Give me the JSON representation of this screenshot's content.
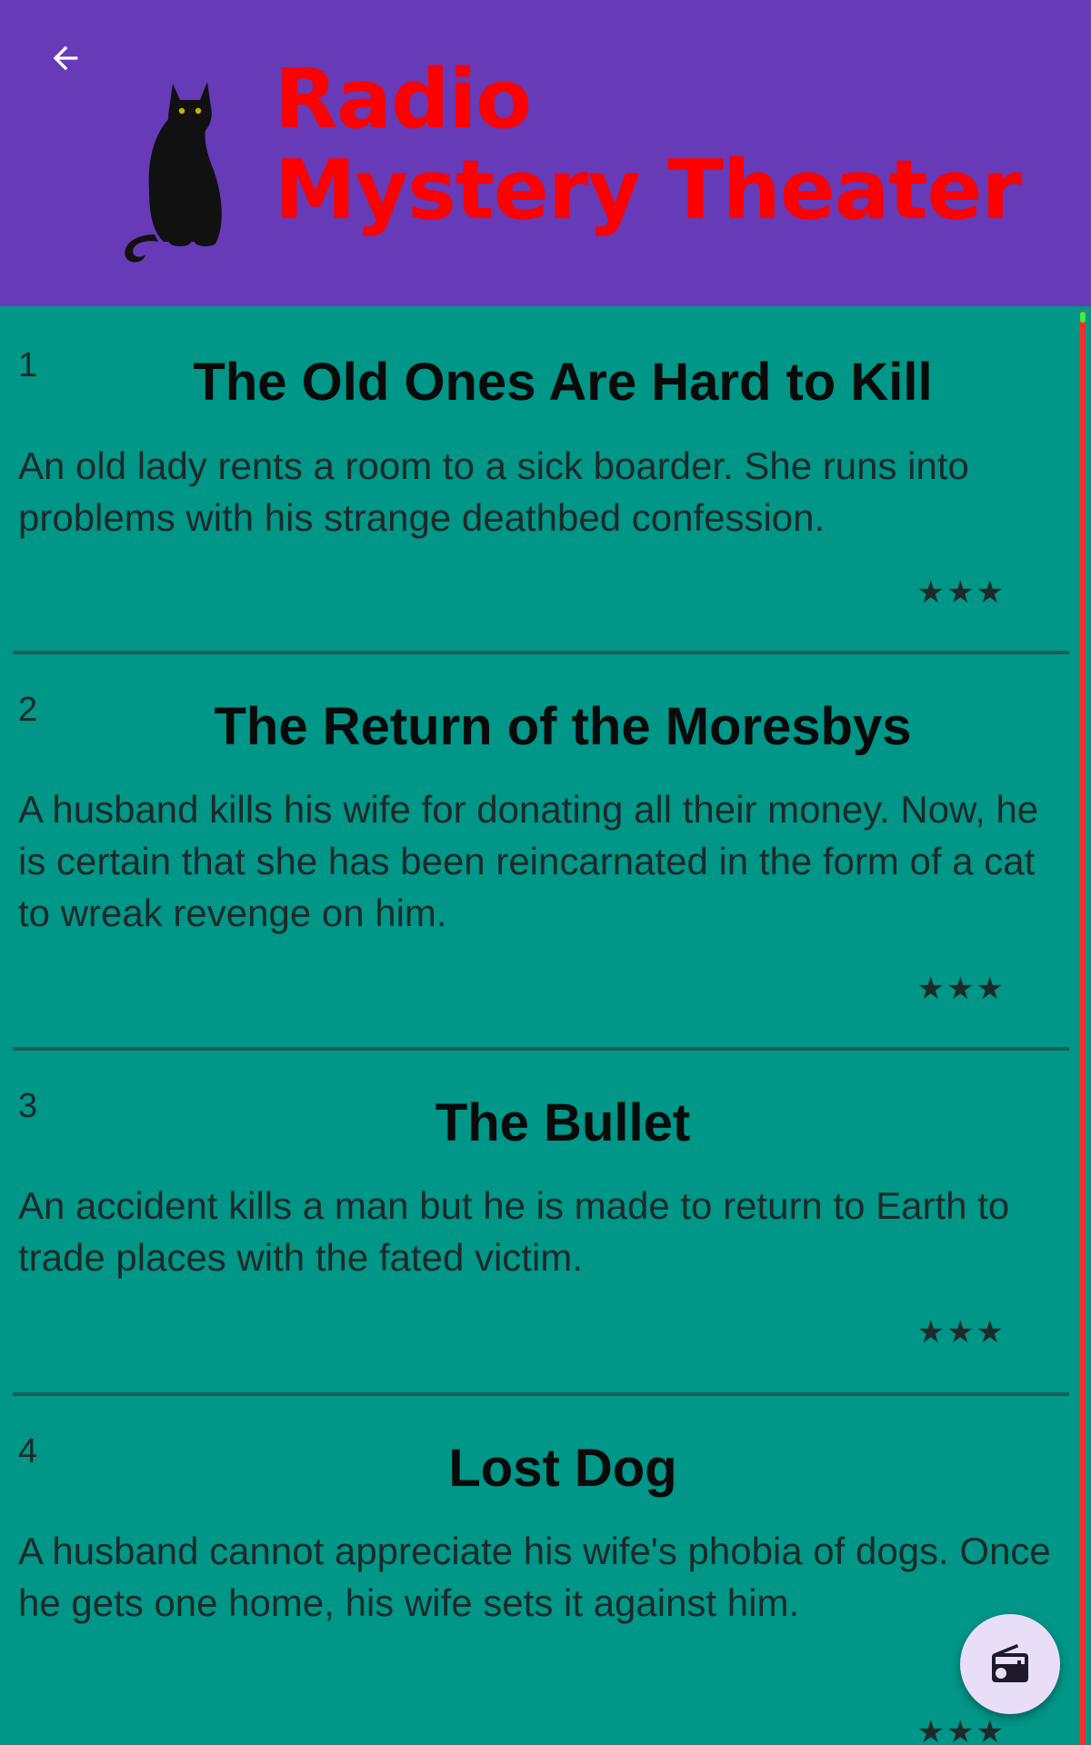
{
  "header": {
    "title_line1": "Radio",
    "title_line2": "Mystery Theater",
    "back_icon": "arrow-back-icon",
    "logo": "black-cat-logo"
  },
  "episodes": [
    {
      "number": "1",
      "title": "The Old Ones Are Hard to Kill",
      "description": "An old lady rents a room to a sick boarder. She runs into problems with his strange deathbed confession.",
      "rating": "★★★"
    },
    {
      "number": "2",
      "title": "The Return of the Moresbys",
      "description": "A husband kills his wife for donating all their money. Now, he is certain that she has been reincarnated in the form of a cat to wreak revenge on him.",
      "rating": "★★★"
    },
    {
      "number": "3",
      "title": "The Bullet",
      "description": "An accident kills a man but he is made to return to Earth to trade places with the fated victim.",
      "rating": "★★★"
    },
    {
      "number": "4",
      "title": "Lost Dog",
      "description": "A husband cannot appreciate his wife's phobia of dogs. Once he gets one home, his wife sets it against him.",
      "rating": "★★★"
    }
  ],
  "fab": {
    "icon": "radio-icon"
  },
  "colors": {
    "app_bar": "#673ab7",
    "background": "#009688",
    "title": "#ff0000",
    "fab": "#e8def8",
    "scrollbar": "#ff2a2a",
    "scrollbar_thumb": "#3df03d"
  }
}
